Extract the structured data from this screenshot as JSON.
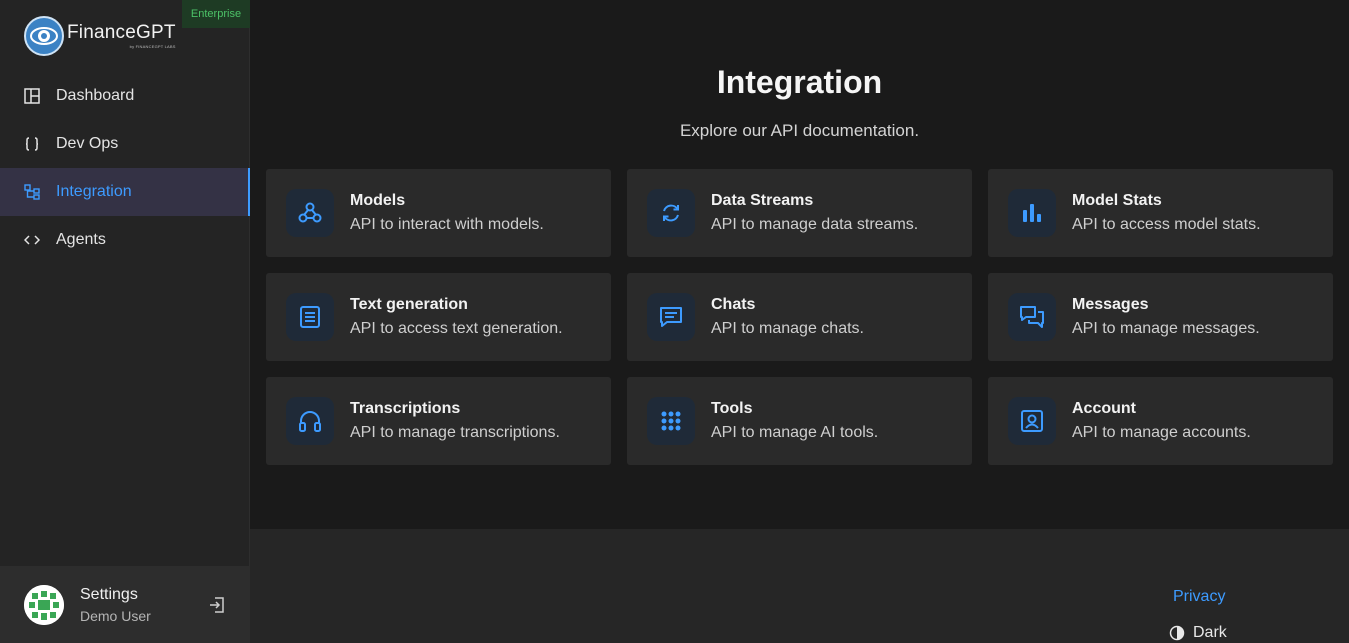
{
  "brand": {
    "name": "FinanceGPT",
    "tagline": "by FINANCEGPT LABS",
    "badge": "Enterprise"
  },
  "sidebar": {
    "items": [
      {
        "label": "Dashboard",
        "icon": "layout-icon",
        "active": false
      },
      {
        "label": "Dev Ops",
        "icon": "braces-icon",
        "active": false
      },
      {
        "label": "Integration",
        "icon": "hierarchy-icon",
        "active": true
      },
      {
        "label": "Agents",
        "icon": "code-icon",
        "active": false
      }
    ]
  },
  "user": {
    "name": "Settings",
    "subtitle": "Demo User"
  },
  "main": {
    "title": "Integration",
    "subtitle": "Explore our API documentation.",
    "cards": [
      {
        "title": "Models",
        "desc": "API to interact with models.",
        "icon": "webhook-icon"
      },
      {
        "title": "Data Streams",
        "desc": "API to manage data streams.",
        "icon": "refresh-icon"
      },
      {
        "title": "Model Stats",
        "desc": "API to access model stats.",
        "icon": "bar-chart-icon"
      },
      {
        "title": "Text generation",
        "desc": "API to access text generation.",
        "icon": "document-icon"
      },
      {
        "title": "Chats",
        "desc": "API to manage chats.",
        "icon": "chat-icon"
      },
      {
        "title": "Messages",
        "desc": "API to manage messages.",
        "icon": "messages-icon"
      },
      {
        "title": "Transcriptions",
        "desc": "API to manage transcriptions.",
        "icon": "headphones-icon"
      },
      {
        "title": "Tools",
        "desc": "API to manage AI tools.",
        "icon": "grid-icon"
      },
      {
        "title": "Account",
        "desc": "API to manage accounts.",
        "icon": "account-icon"
      }
    ]
  },
  "footer": {
    "privacy": "Privacy",
    "theme": "Dark"
  },
  "colors": {
    "accent": "#3d9bff",
    "badge_text": "#4cc267",
    "sidebar_bg": "#242424",
    "main_bg": "#1a1a1a",
    "card_bg": "#2a2a2a"
  }
}
